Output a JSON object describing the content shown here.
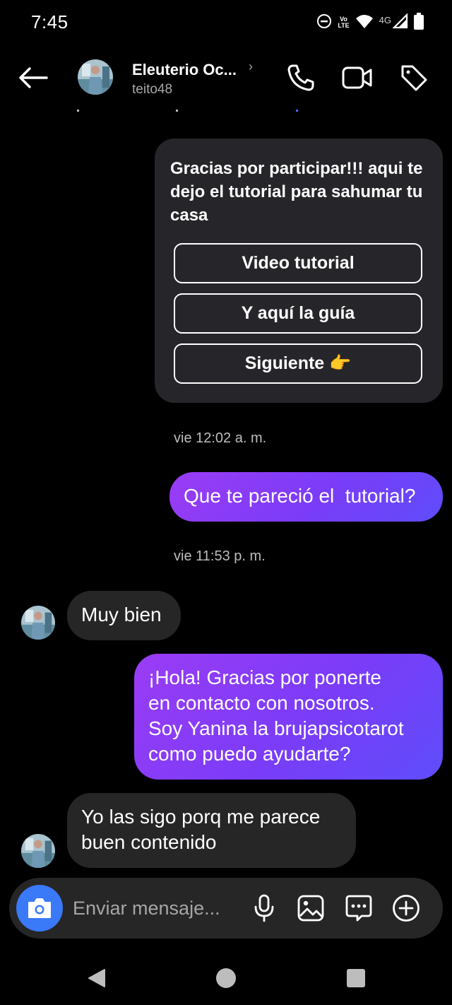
{
  "status_bar": {
    "time": "7:45",
    "volte_top": "Vo",
    "volte_bottom": "LTE",
    "network": "4G",
    "icons": [
      "dnd-icon",
      "volte-icon",
      "wifi-icon",
      "signal-icon",
      "battery-icon"
    ]
  },
  "header": {
    "contact_name": "Eleuterio Oc...",
    "username": "teito48",
    "chevron": "›",
    "icons": [
      "back-arrow-icon",
      "phone-icon",
      "video-camera-icon",
      "tag-icon"
    ]
  },
  "card": {
    "text": "Gracias por participar!!! aqui te dejo el tutorial para sahumar tu casa",
    "buttons": [
      {
        "label": "Video tutorial"
      },
      {
        "label": "Y aquí la guía"
      },
      {
        "label": "Siguiente 👉"
      }
    ]
  },
  "messages": [
    {
      "type": "timestamp",
      "text": "vie 12:02 a. m."
    },
    {
      "type": "outgoing",
      "text": "Que te pareció el  tutorial?"
    },
    {
      "type": "timestamp",
      "text": "vie 11:53 p. m."
    },
    {
      "type": "incoming",
      "text": "Muy bien"
    },
    {
      "type": "outgoing",
      "lines": [
        "¡Hola! Gracias por ponerte",
        "en contacto con nosotros.",
        "Soy Yanina la brujapsicotarot",
        "como puedo ayudarte?"
      ]
    },
    {
      "type": "incoming",
      "lines": [
        "Yo las sigo porq me parece",
        "buen contenido"
      ]
    }
  ],
  "composer": {
    "placeholder": "Enviar mensaje...",
    "value": "",
    "icons": [
      "camera-icon",
      "microphone-icon",
      "gallery-icon",
      "chat-sticker-icon",
      "add-icon"
    ]
  },
  "colors": {
    "background": "#000000",
    "incoming_bubble": "#262626",
    "card": "#26262a",
    "outgoing_gradient": [
      "#9b3cf5",
      "#5e4dfa"
    ],
    "camera_button": "#3a79f7"
  },
  "navigation": {
    "icons": [
      "nav-back-icon",
      "nav-home-icon",
      "nav-recents-icon"
    ]
  }
}
